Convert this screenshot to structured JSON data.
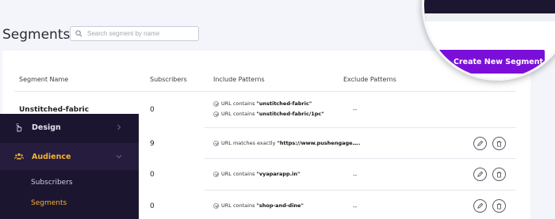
{
  "header": {
    "title": "Segments",
    "search_placeholder": "Search segment by name",
    "create_button_label": "Create New Segment"
  },
  "table": {
    "columns": [
      "Segment Name",
      "Subscribers",
      "Include Patterns",
      "Exclude Patterns"
    ],
    "rows": [
      {
        "name": "Unstitched-fabric",
        "subscribers": "0",
        "patterns": [
          {
            "prefix": "URL contains",
            "value": "\"unstitched-fabric\""
          },
          {
            "prefix": "URL contains",
            "value": "\"unstitched-fabric/1pc\""
          }
        ],
        "exclude": "--"
      },
      {
        "name": "",
        "subscribers": "9",
        "patterns": [
          {
            "prefix": "URL matches exactly",
            "value": "\"https://www.pushengage...."
          }
        ],
        "exclude": "--"
      },
      {
        "name": "",
        "subscribers": "0",
        "patterns": [
          {
            "prefix": "URL contains",
            "value": "\"vyaparapp.in\""
          }
        ],
        "exclude": "--"
      },
      {
        "name": "",
        "subscribers": "0",
        "patterns": [
          {
            "prefix": "URL contains",
            "value": "\"shop-and-dine\""
          }
        ],
        "exclude": "--"
      }
    ]
  },
  "sidebar": {
    "items": [
      {
        "label": "Design",
        "icon": "hand-pointer-icon",
        "chevron": "chevron-right-icon"
      },
      {
        "label": "Audience",
        "icon": "users-icon",
        "chevron": "chevron-down-icon"
      }
    ],
    "subitems": [
      "Subscribers",
      "Segments"
    ]
  },
  "colors": {
    "accent": "#7b0fd9",
    "sidebar_bg": "#1c1530",
    "sidebar_active": "#f2b233"
  }
}
